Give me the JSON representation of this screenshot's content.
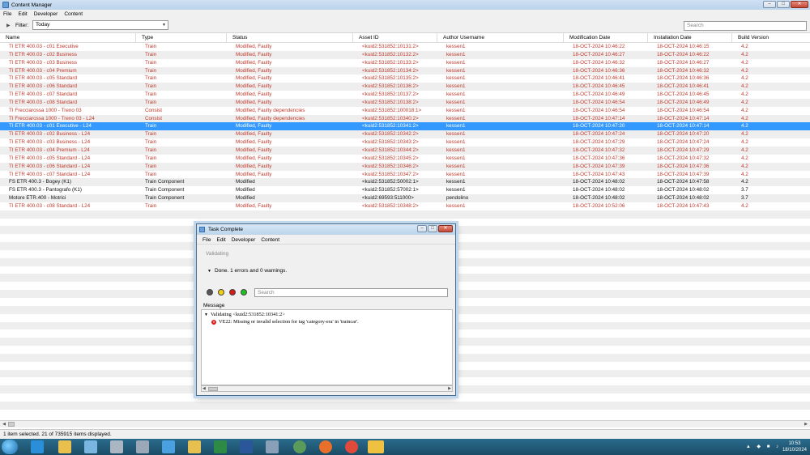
{
  "window": {
    "title": "Content Manager",
    "menu": [
      "File",
      "Edit",
      "Developer",
      "Content"
    ]
  },
  "filter": {
    "label": "Filter:",
    "value": "Today",
    "search_placeholder": "Search"
  },
  "table": {
    "columns": [
      "Name",
      "Type",
      "Status",
      "Asset ID",
      "Author Username",
      "Modification Date",
      "Installation Date",
      "Build Version"
    ],
    "rows": [
      {
        "name": "TI ETR 400.03 - c01 Executive",
        "type": "Train",
        "status": "Modified, Faulty",
        "asset": "<kuid2:531852:10131:2>",
        "author": "kessen1",
        "mod": "18-OCT-2024 10:46:22",
        "inst": "18-OCT-2024 10:46:15",
        "build": "4.2",
        "color": "red"
      },
      {
        "name": "TI ETR 400.03 - c02 Business",
        "type": "Train",
        "status": "Modified, Faulty",
        "asset": "<kuid2:531852:10132:2>",
        "author": "kessen1",
        "mod": "18-OCT-2024 10:46:27",
        "inst": "18-OCT-2024 10:46:22",
        "build": "4.2",
        "color": "red"
      },
      {
        "name": "TI ETR 400.03 - c03 Business",
        "type": "Train",
        "status": "Modified, Faulty",
        "asset": "<kuid2:531852:10133:2>",
        "author": "kessen1",
        "mod": "18-OCT-2024 10:46:32",
        "inst": "18-OCT-2024 10:46:27",
        "build": "4.2",
        "color": "red"
      },
      {
        "name": "TI ETR 400.03 - c04 Premium",
        "type": "Train",
        "status": "Modified, Faulty",
        "asset": "<kuid2:531852:10134:2>",
        "author": "kessen1",
        "mod": "18-OCT-2024 10:46:36",
        "inst": "18-OCT-2024 10:46:32",
        "build": "4.2",
        "color": "red"
      },
      {
        "name": "TI ETR 400.03 - c05 Standard",
        "type": "Train",
        "status": "Modified, Faulty",
        "asset": "<kuid2:531852:10135:2>",
        "author": "kessen1",
        "mod": "18-OCT-2024 10:46:41",
        "inst": "18-OCT-2024 10:46:36",
        "build": "4.2",
        "color": "red"
      },
      {
        "name": "TI ETR 400.03 - c06 Standard",
        "type": "Train",
        "status": "Modified, Faulty",
        "asset": "<kuid2:531852:10136:2>",
        "author": "kessen1",
        "mod": "18-OCT-2024 10:46:45",
        "inst": "18-OCT-2024 10:46:41",
        "build": "4.2",
        "color": "red"
      },
      {
        "name": "TI ETR 400.03 - c07 Standard",
        "type": "Train",
        "status": "Modified, Faulty",
        "asset": "<kuid2:531852:10137:2>",
        "author": "kessen1",
        "mod": "18-OCT-2024 10:46:49",
        "inst": "18-OCT-2024 10:46:45",
        "build": "4.2",
        "color": "red"
      },
      {
        "name": "TI ETR 400.03 - c08 Standard",
        "type": "Train",
        "status": "Modified, Faulty",
        "asset": "<kuid2:531852:10138:2>",
        "author": "kessen1",
        "mod": "18-OCT-2024 10:46:54",
        "inst": "18-OCT-2024 10:46:49",
        "build": "4.2",
        "color": "red"
      },
      {
        "name": "TI Frecciarossa 1000 - Treno 03",
        "type": "Consist",
        "status": "Modified, Faulty dependencies",
        "asset": "<kuid2:531852:100018:1>",
        "author": "kessen1",
        "mod": "18-OCT-2024 10:46:54",
        "inst": "18-OCT-2024 10:46:54",
        "build": "4.2",
        "color": "red"
      },
      {
        "name": "TI Frecciarossa 1000 - Treno 03 - L24",
        "type": "Consist",
        "status": "Modified, Faulty dependencies",
        "asset": "<kuid2:531852:10340:2>",
        "author": "kessen1",
        "mod": "18-OCT-2024 10:47:14",
        "inst": "18-OCT-2024 10:47:14",
        "build": "4.2",
        "color": "red"
      },
      {
        "name": "TI ETR 400.03 - c01 Executive - L24",
        "type": "Train",
        "status": "Modified, Faulty",
        "asset": "<kuid2:531852:10341:2>",
        "author": "kessen1",
        "mod": "18-OCT-2024 10:47:20",
        "inst": "18-OCT-2024 10:47:14",
        "build": "4.2",
        "color": "red",
        "selected": true
      },
      {
        "name": "TI ETR 400.03 - c02 Business - L24",
        "type": "Train",
        "status": "Modified, Faulty",
        "asset": "<kuid2:531852:10342:2>",
        "author": "kessen1",
        "mod": "18-OCT-2024 10:47:24",
        "inst": "18-OCT-2024 10:47:20",
        "build": "4.2",
        "color": "red"
      },
      {
        "name": "TI ETR 400.03 - c03 Business - L24",
        "type": "Train",
        "status": "Modified, Faulty",
        "asset": "<kuid2:531852:10343:2>",
        "author": "kessen1",
        "mod": "18-OCT-2024 10:47:29",
        "inst": "18-OCT-2024 10:47:24",
        "build": "4.2",
        "color": "red"
      },
      {
        "name": "TI ETR 400.03 - c04 Premium - L24",
        "type": "Train",
        "status": "Modified, Faulty",
        "asset": "<kuid2:531852:10344:2>",
        "author": "kessen1",
        "mod": "18-OCT-2024 10:47:32",
        "inst": "18-OCT-2024 10:47:29",
        "build": "4.2",
        "color": "red"
      },
      {
        "name": "TI ETR 400.03 - c05 Standard - L24",
        "type": "Train",
        "status": "Modified, Faulty",
        "asset": "<kuid2:531852:10345:2>",
        "author": "kessen1",
        "mod": "18-OCT-2024 10:47:36",
        "inst": "18-OCT-2024 10:47:32",
        "build": "4.2",
        "color": "red"
      },
      {
        "name": "TI ETR 400.03 - c06 Standard - L24",
        "type": "Train",
        "status": "Modified, Faulty",
        "asset": "<kuid2:531852:10346:2>",
        "author": "kessen1",
        "mod": "18-OCT-2024 10:47:39",
        "inst": "18-OCT-2024 10:47:36",
        "build": "4.2",
        "color": "red"
      },
      {
        "name": "TI ETR 400.03 - c07 Standard - L24",
        "type": "Train",
        "status": "Modified, Faulty",
        "asset": "<kuid2:531852:10347:2>",
        "author": "kessen1",
        "mod": "18-OCT-2024 10:47:43",
        "inst": "18-OCT-2024 10:47:39",
        "build": "4.2",
        "color": "red"
      },
      {
        "name": "FS ETR 400.3 - Bogey (K1)",
        "type": "Train Component",
        "status": "Modified",
        "asset": "<kuid2:531852:50002:1>",
        "author": "kessen1",
        "mod": "18-OCT-2024 10:48:02",
        "inst": "18-OCT-2024 10:47:58",
        "build": "4.2",
        "color": "black"
      },
      {
        "name": "FS ETR 400.3 - Pantografo (K1)",
        "type": "Train Component",
        "status": "Modified",
        "asset": "<kuid2:531852:57002:1>",
        "author": "kessen1",
        "mod": "18-OCT-2024 10:48:02",
        "inst": "18-OCT-2024 10:48:02",
        "build": "3.7",
        "color": "black"
      },
      {
        "name": "Motore ETR.400 - Motrici",
        "type": "Train Component",
        "status": "Modified",
        "asset": "<kuid2:69593:511000>",
        "author": "pendolino",
        "mod": "18-OCT-2024 10:48:02",
        "inst": "18-OCT-2024 10:48:02",
        "build": "3.7",
        "color": "black"
      },
      {
        "name": "TI ETR 400.03 - c08 Standard - L24",
        "type": "Train",
        "status": "Modified, Faulty",
        "asset": "<kuid2:531852:10348:2>",
        "author": "kessen1",
        "mod": "18-OCT-2024 10:52:06",
        "inst": "18-OCT-2024 10:47:43",
        "build": "4.2",
        "color": "red"
      }
    ]
  },
  "status_bar": "1 item selected. 21 of 735915 items displayed.",
  "dialog": {
    "title": "Task Complete",
    "menu": [
      "File",
      "Edit",
      "Developer",
      "Content"
    ],
    "validating": "Validating",
    "done": "Done. 1 errors and 0 warnings.",
    "search_placeholder": "Search",
    "message_label": "Message",
    "tree_parent": "Validating <kuid2:531852:10341:2>",
    "tree_error": "VE22: Missing or invalid selection for tag 'category-era' in 'traincar'."
  },
  "taskbar": {
    "time": "10:53",
    "date": "18/10/2024"
  },
  "colors": {
    "faulty_text": "#c0392b",
    "selection": "#3399ff",
    "taskbar": "#1f5b7a"
  }
}
